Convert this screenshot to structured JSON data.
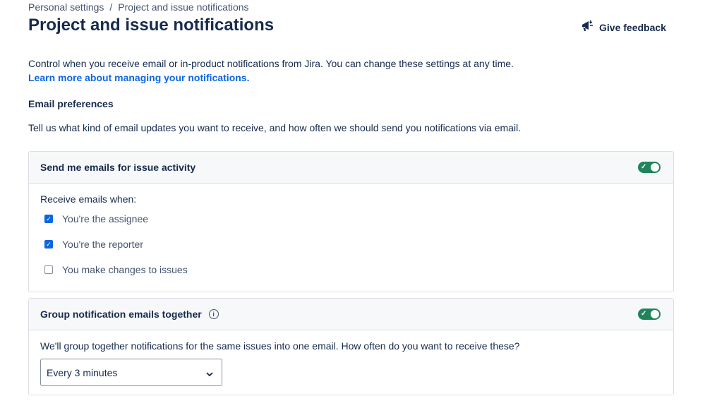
{
  "breadcrumb": [
    "Personal settings",
    "Project and issue notifications"
  ],
  "title": "Project and issue notifications",
  "feedback": "Give feedback",
  "intro": "Control when you receive email or in-product notifications from Jira. You can change these settings at any time.",
  "learn_more": "Learn more about managing your notifications.",
  "email_prefs": {
    "heading": "Email preferences",
    "description": "Tell us what kind of email updates you want to receive, and how often we should send you notifications via email."
  },
  "issue_activity": {
    "title": "Send me emails for issue activity",
    "enabled": true,
    "label": "Receive emails when:",
    "options": [
      {
        "label": "You're the assignee",
        "checked": true
      },
      {
        "label": "You're the reporter",
        "checked": true
      },
      {
        "label": "You make changes to issues",
        "checked": false
      }
    ]
  },
  "grouping": {
    "title": "Group notification emails together",
    "enabled": true,
    "description": "We'll group together notifications for the same issues into one email. How often do you want to receive these?",
    "frequency": "Every 3 minutes"
  },
  "colors": {
    "toggle": "#1f845a",
    "checkbox": "#0c66e4",
    "link": "#0c66e4"
  }
}
